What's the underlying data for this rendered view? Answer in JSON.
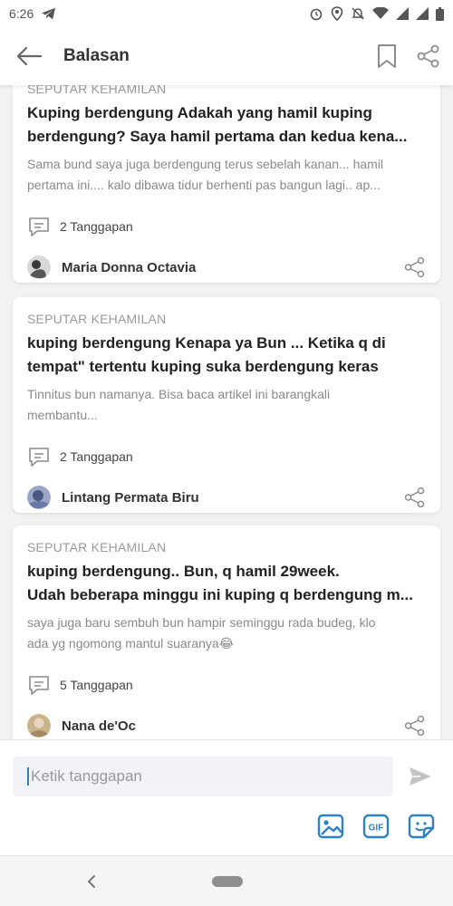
{
  "status_bar": {
    "time": "6:26"
  },
  "header": {
    "title": "Balasan"
  },
  "cards": [
    {
      "category": "SEPUTAR KEHAMILAN",
      "title_lines": [
        "Kuping berdengung Adakah yang hamil kuping",
        "berdengung? Saya hamil pertama dan kedua kena..."
      ],
      "excerpt_lines": [
        "Sama bund saya juga berdengung terus sebelah kanan... hamil",
        "pertama ini.... kalo dibawa tidur berhenti pas bangun lagi.. ap..."
      ],
      "responses": "2 Tanggapan",
      "user": "Maria Donna Octavia"
    },
    {
      "category": "SEPUTAR KEHAMILAN",
      "title_lines": [
        "kuping berdengung Kenapa ya Bun ... Ketika q di",
        "tempat\" tertentu kuping suka berdengung keras"
      ],
      "excerpt_lines": [
        "Tinnitus bun namanya. Bisa baca artikel ini barangkali",
        "membantu..."
      ],
      "responses": "2 Tanggapan",
      "user": "Lintang Permata Biru"
    },
    {
      "category": "SEPUTAR KEHAMILAN",
      "title_lines": [
        "kuping berdengung.. Bun, q hamil 29week.",
        "Udah beberapa minggu ini kuping q berdengung m..."
      ],
      "excerpt_lines": [
        "saya juga baru sembuh bun hampir seminggu rada budeg, klo",
        "ada yg ngomong mantul suaranya😂"
      ],
      "responses": "5 Tanggapan",
      "user": "Nana de'Oc"
    }
  ],
  "reply": {
    "placeholder": "Ketik tanggapan",
    "value": ""
  },
  "colors": {
    "accent": "#2f80c3",
    "icon_gray": "#8c8c8c",
    "background": "#f2f2f2"
  }
}
